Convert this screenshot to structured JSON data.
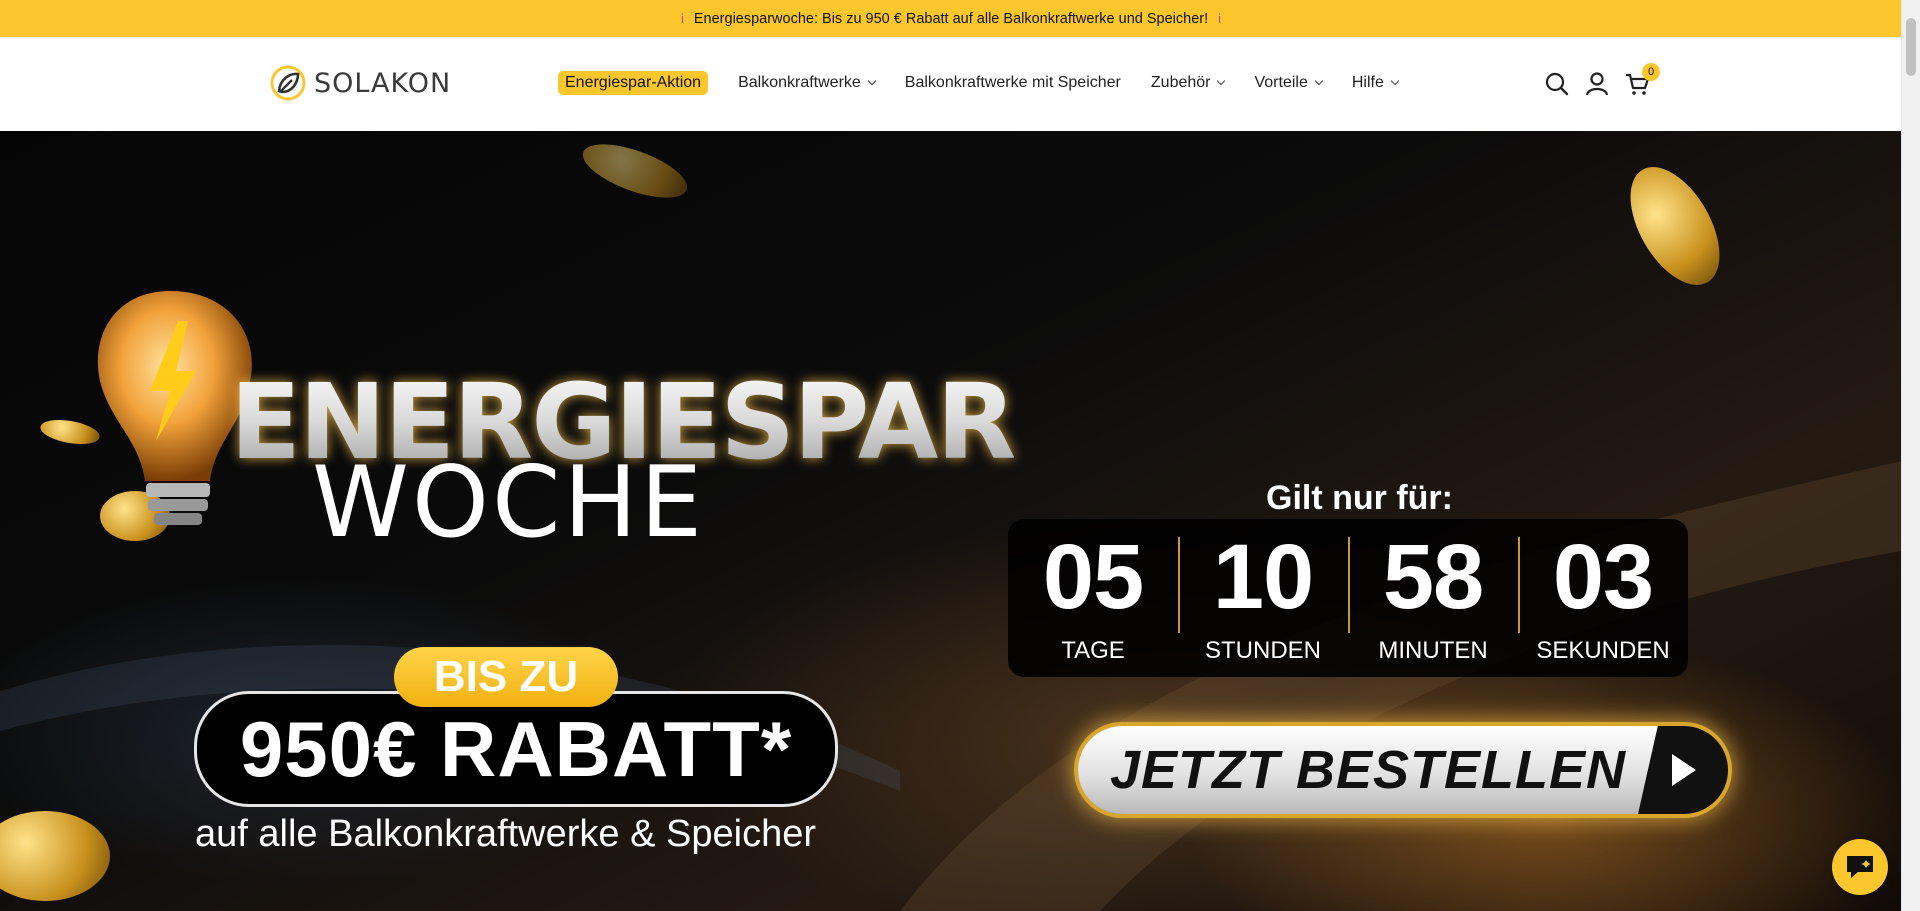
{
  "announcement": {
    "text": "Energiesparwoche: Bis zu 950 € Rabatt auf alle Balkonkraftwerke und Speicher!",
    "dot_left": "i",
    "dot_right": "i"
  },
  "header": {
    "logo_text": "SOLAKON",
    "nav": [
      {
        "label": "Energiespar-Aktion",
        "dropdown": false,
        "highlight": true
      },
      {
        "label": "Balkonkraftwerke",
        "dropdown": true
      },
      {
        "label": "Balkonkraftwerke mit Speicher",
        "dropdown": false
      },
      {
        "label": "Zubehör",
        "dropdown": true
      },
      {
        "label": "Vorteile",
        "dropdown": true
      },
      {
        "label": "Hilfe",
        "dropdown": true
      }
    ],
    "icons": [
      "search-icon",
      "account-icon",
      "cart-icon"
    ],
    "cart_count": "0"
  },
  "hero": {
    "title_line1": "ENERGIESPAR",
    "title_line2": "WOCHE",
    "badge_small": "BIS ZU",
    "badge_big": "950€ RABATT*",
    "subline": "auf alle Balkonkraftwerke & Speicher",
    "countdown_heading": "Gilt nur für:",
    "countdown": [
      {
        "value": "05",
        "label": "TAGE"
      },
      {
        "value": "10",
        "label": "STUNDEN"
      },
      {
        "value": "58",
        "label": "MINUTEN"
      },
      {
        "value": "03",
        "label": "SEKUNDEN"
      }
    ],
    "cta_label": "JETZT BESTELLEN"
  },
  "colors": {
    "brand_yellow": "#fcc72c",
    "hero_bg": "#0b0b0b",
    "gold_accent": "#d9a62c"
  }
}
